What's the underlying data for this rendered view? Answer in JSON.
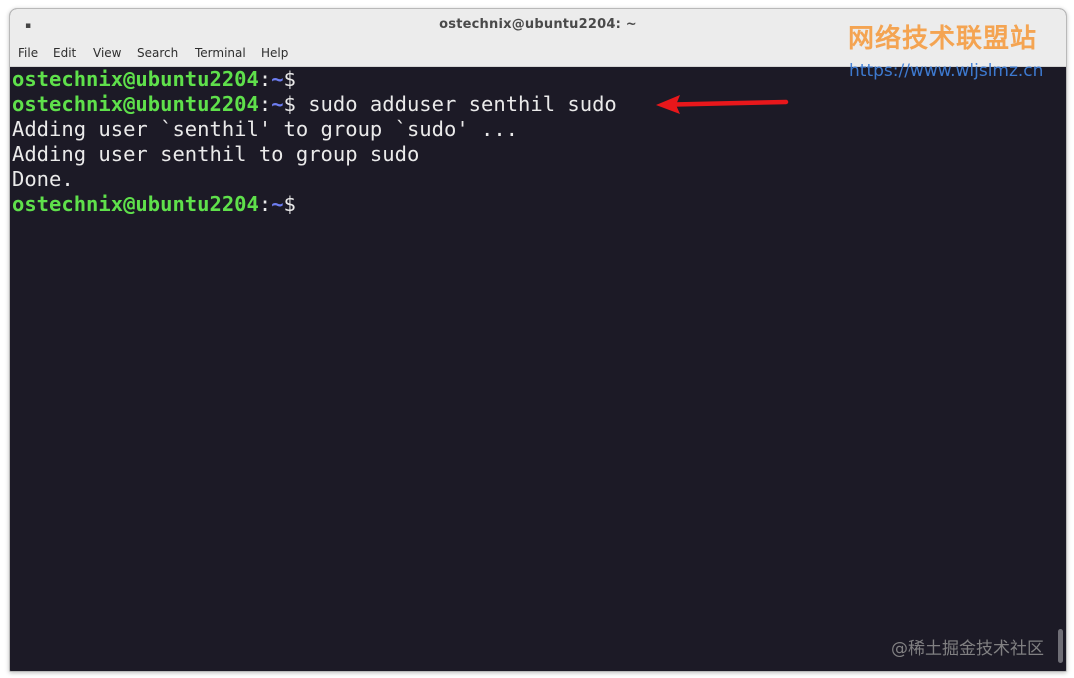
{
  "window": {
    "title": "ostechnix@ubuntu2204: ~",
    "icon": "terminal-icon"
  },
  "menu": {
    "items": [
      {
        "label": "File"
      },
      {
        "label": "Edit"
      },
      {
        "label": "View"
      },
      {
        "label": "Search"
      },
      {
        "label": "Terminal"
      },
      {
        "label": "Help"
      }
    ]
  },
  "terminal": {
    "prompt_user": "ostechnix@ubuntu2204",
    "prompt_colon": ":",
    "prompt_path": "~",
    "prompt_symbol": "$",
    "lines": [
      {
        "type": "prompt",
        "command": ""
      },
      {
        "type": "prompt",
        "command": " sudo adduser senthil sudo"
      },
      {
        "type": "output",
        "text": "Adding user `senthil' to group `sudo' ..."
      },
      {
        "type": "output",
        "text": "Adding user senthil to group sudo"
      },
      {
        "type": "output",
        "text": "Done."
      },
      {
        "type": "prompt",
        "command": ""
      }
    ]
  },
  "annotation": {
    "arrow_color": "#e8171b"
  },
  "watermarks": {
    "site_name": "网络技术联盟站",
    "site_url": "https://www.wljslmz.cn",
    "juejin": "@稀土掘金技术社区"
  },
  "colors": {
    "terminal_bg": "#1c1a26",
    "prompt_user": "#5fe04b",
    "prompt_path": "#6d7df0",
    "text": "#eaeaea"
  }
}
